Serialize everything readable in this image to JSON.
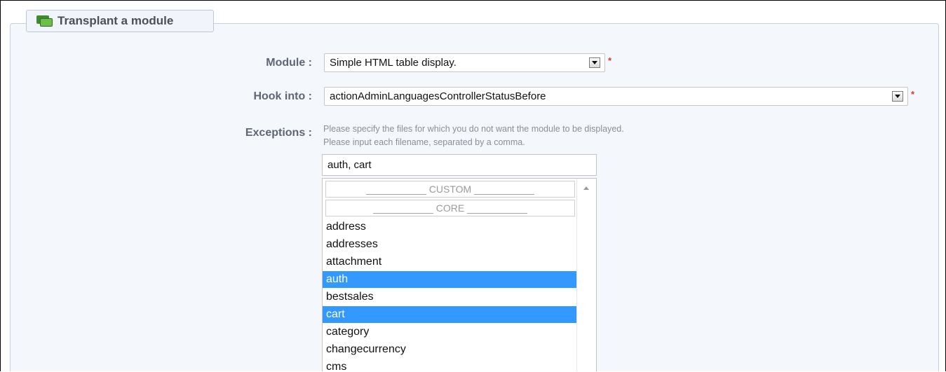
{
  "panel": {
    "title": "Transplant a module"
  },
  "module": {
    "label": "Module :",
    "value": "Simple HTML table display.",
    "required": "*"
  },
  "hook": {
    "label": "Hook into :",
    "value": "actionAdminLanguagesControllerStatusBefore",
    "required": "*"
  },
  "exceptions": {
    "label": "Exceptions :",
    "help_line1": "Please specify the files for which you do not want the module to be displayed.",
    "help_line2": "Please input each filename, separated by a comma.",
    "input_value": "auth, cart",
    "groups": [
      "___________ CUSTOM ___________",
      "___________ CORE ___________"
    ],
    "options": [
      {
        "label": "address",
        "selected": false
      },
      {
        "label": "addresses",
        "selected": false
      },
      {
        "label": "attachment",
        "selected": false
      },
      {
        "label": "auth",
        "selected": true
      },
      {
        "label": "bestsales",
        "selected": false
      },
      {
        "label": "cart",
        "selected": true
      },
      {
        "label": "category",
        "selected": false
      },
      {
        "label": "changecurrency",
        "selected": false
      },
      {
        "label": "cms",
        "selected": false
      }
    ]
  },
  "colors": {
    "selected": "#3399ff",
    "required": "#e0342f",
    "label": "#5f6673"
  },
  "icons": {
    "panel": "modules-icon",
    "dropdown": "chevron-down-icon",
    "scroll_up": "scroll-up-icon"
  }
}
